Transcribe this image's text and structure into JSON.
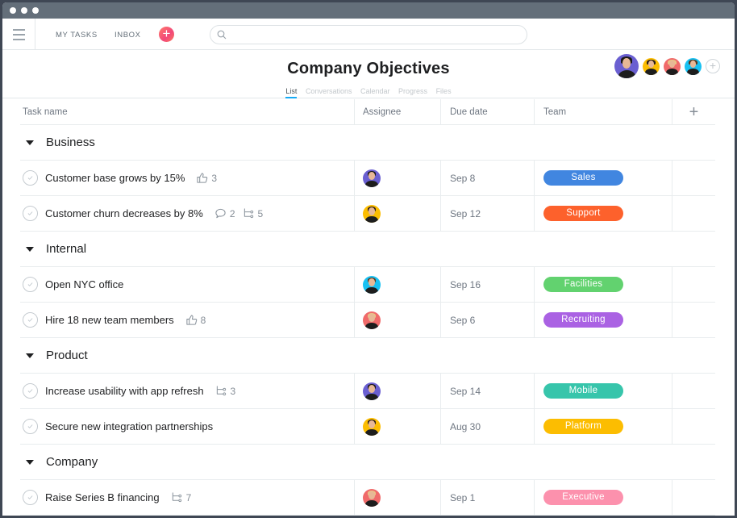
{
  "topbar": {
    "nav": [
      {
        "label": "MY TASKS"
      },
      {
        "label": "INBOX"
      }
    ],
    "search_placeholder": ""
  },
  "header": {
    "title": "Company Objectives",
    "tabs": [
      {
        "label": "List",
        "active": true
      },
      {
        "label": "Conversations"
      },
      {
        "label": "Calendar"
      },
      {
        "label": "Progress"
      },
      {
        "label": "Files"
      }
    ],
    "members": [
      {
        "name": "member-1",
        "bg": "#6a5fd1",
        "hair": "#1b1816"
      },
      {
        "name": "member-2",
        "bg": "#fcbd01",
        "hair": "#2b1e17"
      },
      {
        "name": "member-3",
        "bg": "#f06a6a",
        "hair": "#e9c587"
      },
      {
        "name": "member-4",
        "bg": "#18c1f2",
        "hair": "#5a3a22"
      }
    ]
  },
  "columns": {
    "task_name": "Task name",
    "assignee": "Assignee",
    "due_date": "Due date",
    "team": "Team"
  },
  "sections": [
    {
      "name": "Business",
      "tasks": [
        {
          "name": "Customer base grows by 15%",
          "likes": "3",
          "comments": null,
          "subtasks": null,
          "assignee": 0,
          "due": "Sep 8",
          "team": "Sales",
          "team_color": "#4186e0"
        },
        {
          "name": "Customer churn decreases by 8%",
          "likes": null,
          "comments": "2",
          "subtasks": "5",
          "assignee": 1,
          "due": "Sep 12",
          "team": "Support",
          "team_color": "#fd612c"
        }
      ]
    },
    {
      "name": "Internal",
      "tasks": [
        {
          "name": "Open NYC office",
          "likes": null,
          "comments": null,
          "subtasks": null,
          "assignee": 3,
          "due": "Sep 16",
          "team": "Facilities",
          "team_color": "#62d26f"
        },
        {
          "name": "Hire 18 new team members",
          "likes": "8",
          "comments": null,
          "subtasks": null,
          "assignee": 2,
          "due": "Sep 6",
          "team": "Recruiting",
          "team_color": "#aa62e3"
        }
      ]
    },
    {
      "name": "Product",
      "tasks": [
        {
          "name": "Increase usability with app refresh",
          "likes": null,
          "comments": null,
          "subtasks": "3",
          "assignee": 0,
          "due": "Sep 14",
          "team": "Mobile",
          "team_color": "#37c5ab"
        },
        {
          "name": "Secure new integration partnerships",
          "likes": null,
          "comments": null,
          "subtasks": null,
          "assignee": 1,
          "due": "Aug 30",
          "team": "Platform",
          "team_color": "#fcbd01"
        }
      ]
    },
    {
      "name": "Company",
      "tasks": [
        {
          "name": "Raise Series B financing",
          "likes": null,
          "comments": null,
          "subtasks": "7",
          "assignee": 2,
          "due": "Sep 1",
          "team": "Executive",
          "team_color": "#fc91ad"
        }
      ]
    }
  ]
}
